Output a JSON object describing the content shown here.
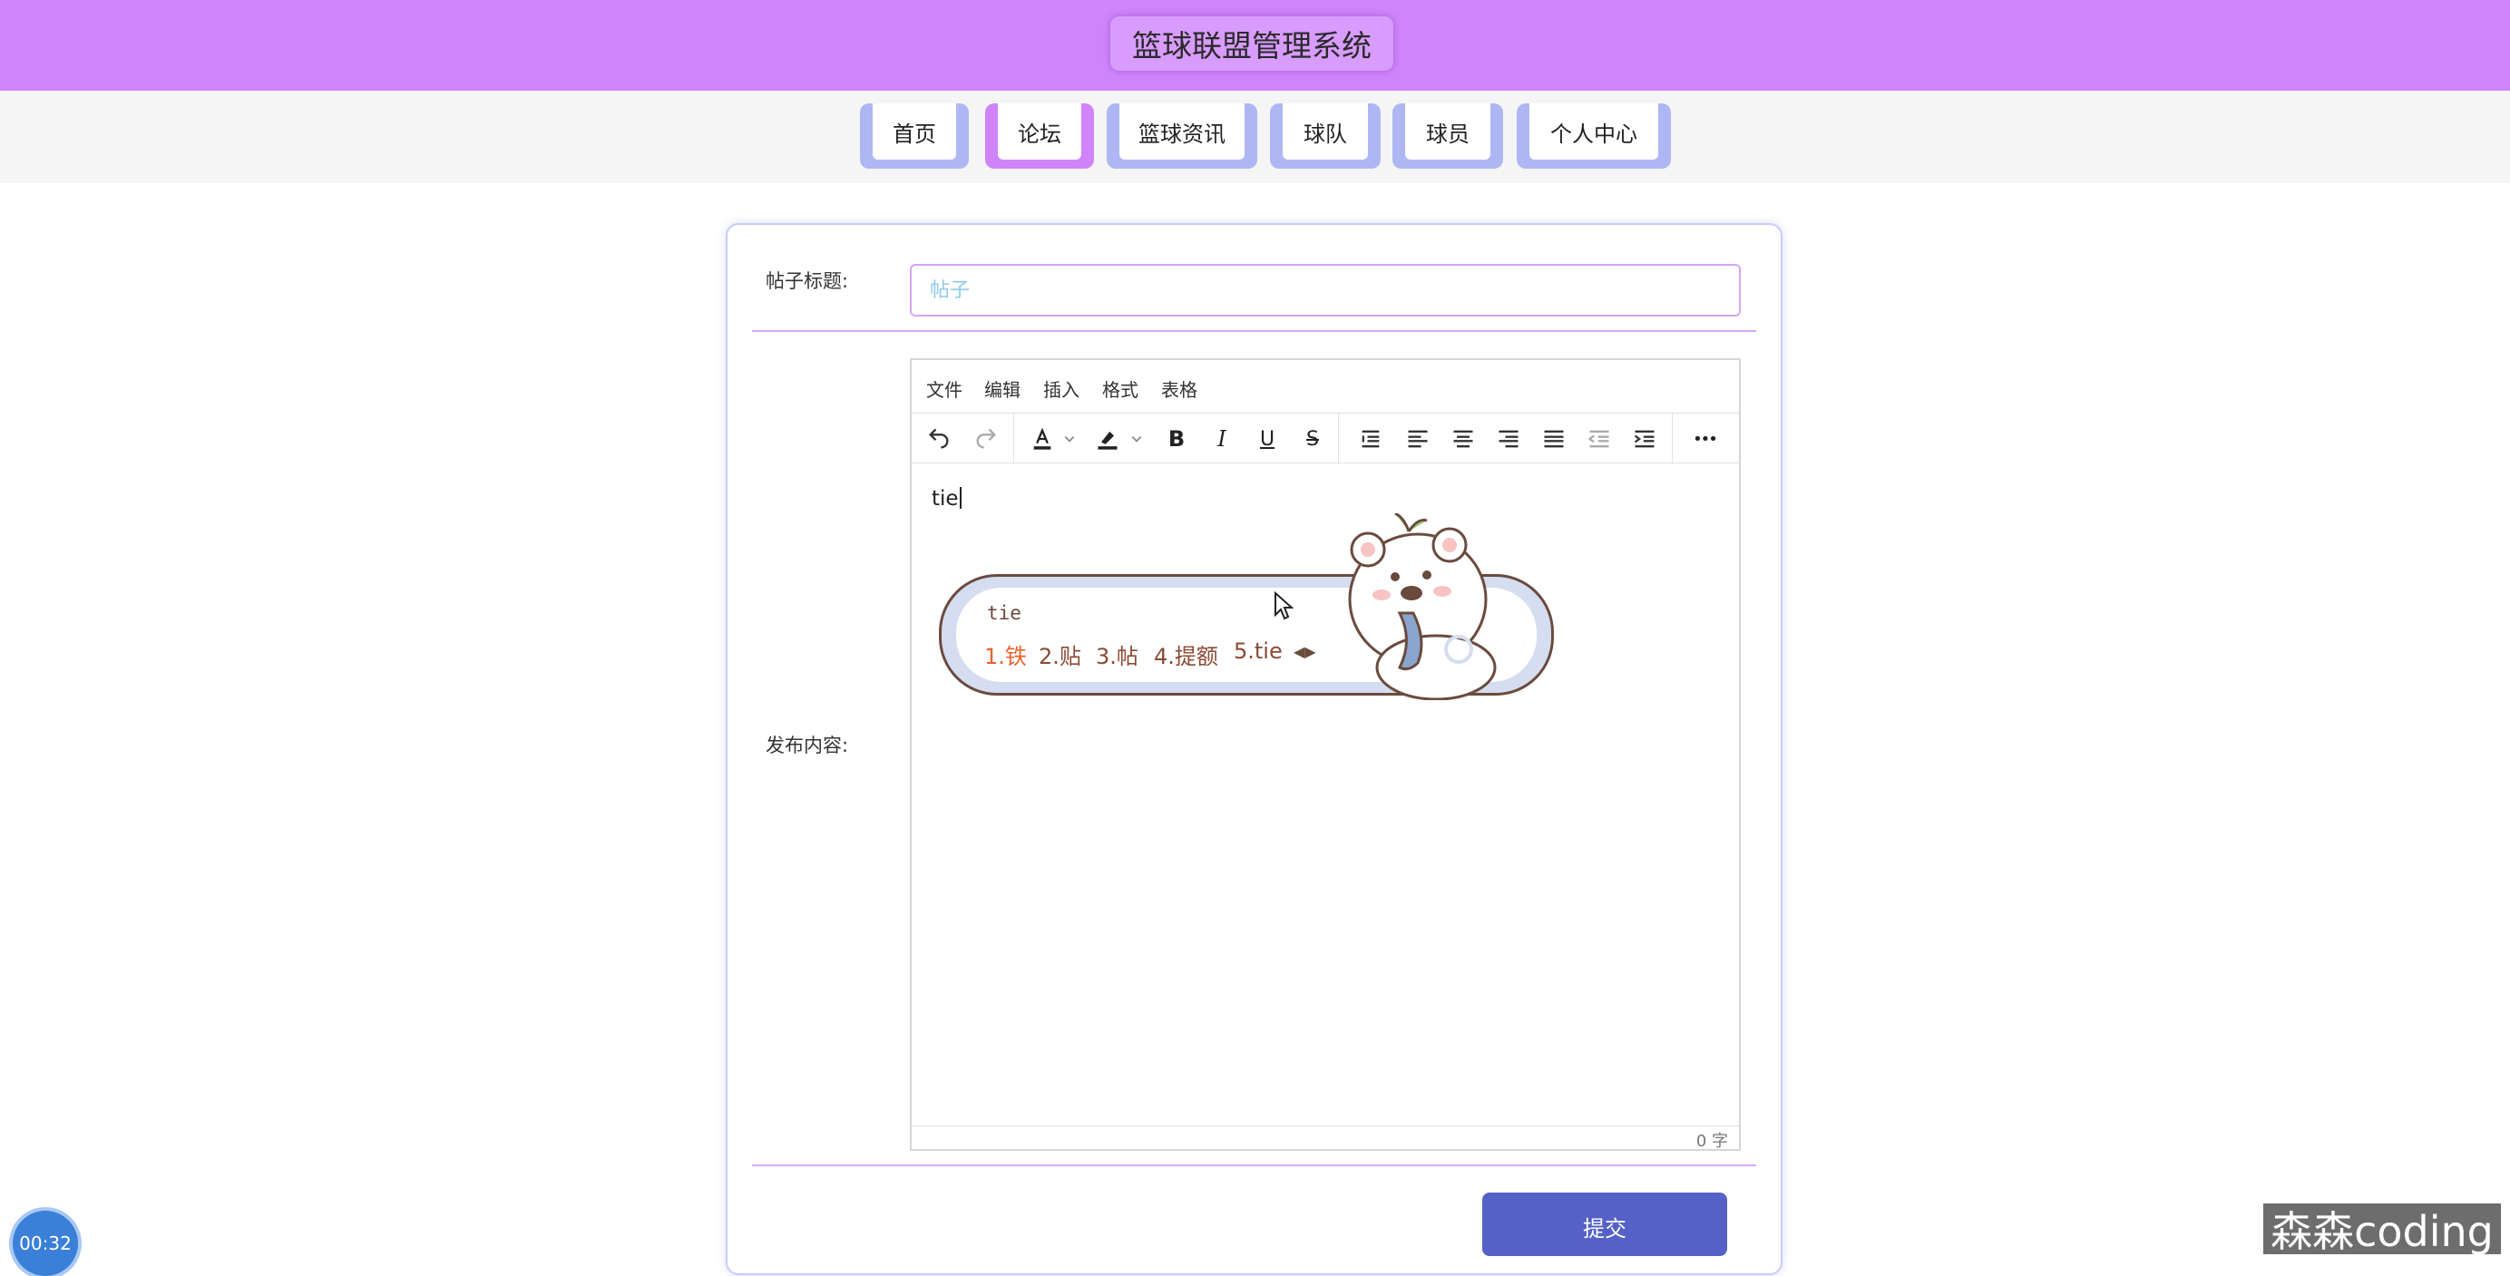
{
  "header": {
    "title": "篮球联盟管理系统"
  },
  "nav": {
    "items": [
      {
        "label": "首页"
      },
      {
        "label": "论坛",
        "active": true
      },
      {
        "label": "篮球资讯"
      },
      {
        "label": "球队"
      },
      {
        "label": "球员"
      },
      {
        "label": "个人中心"
      }
    ]
  },
  "form": {
    "title_label": "帖子标题:",
    "title_placeholder": "帖子",
    "content_label": "发布内容:",
    "submit_label": "提交"
  },
  "editor": {
    "menu": [
      "文件",
      "编辑",
      "插入",
      "格式",
      "表格"
    ],
    "content": "tie",
    "word_count": "0 字",
    "toolbar_icons": [
      "undo-icon",
      "redo-icon",
      "font-color-icon",
      "highlight-icon",
      "bold-icon",
      "italic-icon",
      "underline-icon",
      "strikethrough-icon",
      "line-height-icon",
      "align-left-icon",
      "align-center-icon",
      "align-right-icon",
      "align-justify-icon",
      "outdent-icon",
      "indent-icon",
      "more-icon"
    ],
    "bold_glyph": "B",
    "italic_glyph": "I",
    "underline_glyph": "U",
    "strike_glyph": "S",
    "more_glyph": "•••"
  },
  "ime": {
    "input": "tie",
    "candidates": [
      "1.铁",
      "2.贴",
      "3.帖",
      "4.提额",
      "5.tie"
    ],
    "arrows": "◀▶"
  },
  "overlay": {
    "timer": "00:32",
    "watermark": "森森coding"
  },
  "colors": {
    "header_bg": "#cf84fc",
    "nav_tab": "#aeb7f3",
    "nav_active": "#cf84fc",
    "submit_bg": "#5561c7"
  }
}
